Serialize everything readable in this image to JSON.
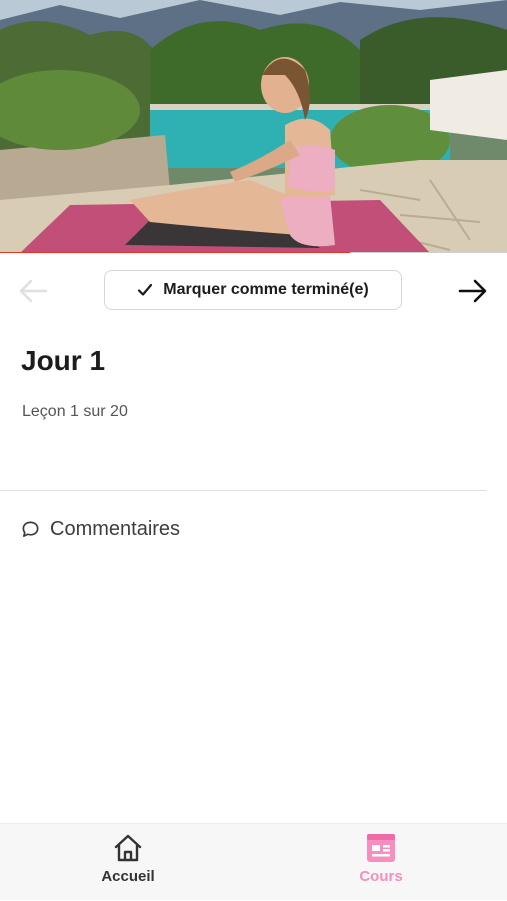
{
  "video": {
    "description_icon": "video-player",
    "progress": 0.69,
    "progress_color": "#e5332a"
  },
  "lesson_nav": {
    "complete_label": "Marquer comme terminé(e)",
    "prev_icon": "arrow-left-icon",
    "next_icon": "arrow-right-icon"
  },
  "lesson": {
    "title": "Jour 1",
    "subtitle": "Leçon 1 sur 20"
  },
  "comments": {
    "label": "Commentaires",
    "icon": "chat-bubble-icon"
  },
  "tabbar": {
    "items": [
      {
        "label": "Accueil",
        "icon": "home-icon",
        "active": false
      },
      {
        "label": "Cours",
        "icon": "course-icon",
        "active": true,
        "color": "#f48fc0"
      }
    ]
  }
}
